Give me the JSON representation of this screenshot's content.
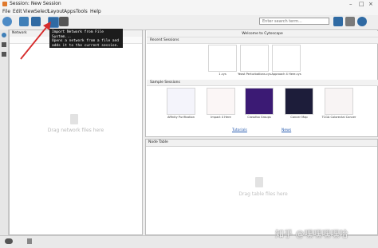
{
  "window": {
    "title": "Session: New Session"
  },
  "menu": [
    "File",
    "Edit",
    "View",
    "Select",
    "Layout",
    "Apps",
    "Tools",
    "Help"
  ],
  "search": {
    "placeholder": "Enter search term..."
  },
  "tooltip": {
    "title": "Import Network from File System...",
    "body": "Opens a network from a file and adds it to the current session."
  },
  "network_panel": {
    "tab_label": "Network",
    "drop_hint": "Drag network files here"
  },
  "welcome": {
    "title": "Welcome to Cytoscape",
    "recent_label": "Recent Sessions",
    "recent": [
      "1.cys",
      "Yeast PerturbatIons.cys",
      "Approach 4 Here.cys"
    ],
    "sample_label": "Sample Sessions",
    "samples": [
      "Affinity Purification",
      "Impact 4 Here",
      "Crossfoo Groups",
      "Cancer Map",
      "TCGA Colorectal Cancer"
    ],
    "tutorials": "Tutorials",
    "news": "News"
  },
  "node_panel": {
    "tab_label": "Node Table",
    "drop_hint": "Drag table files here"
  },
  "watermark": "知乎 @嘿嘿嘿嘿哈",
  "colors": {
    "accent": "#2a5db0",
    "arrow": "#d62b2b",
    "tooltip_bg": "#1c1c1c"
  }
}
